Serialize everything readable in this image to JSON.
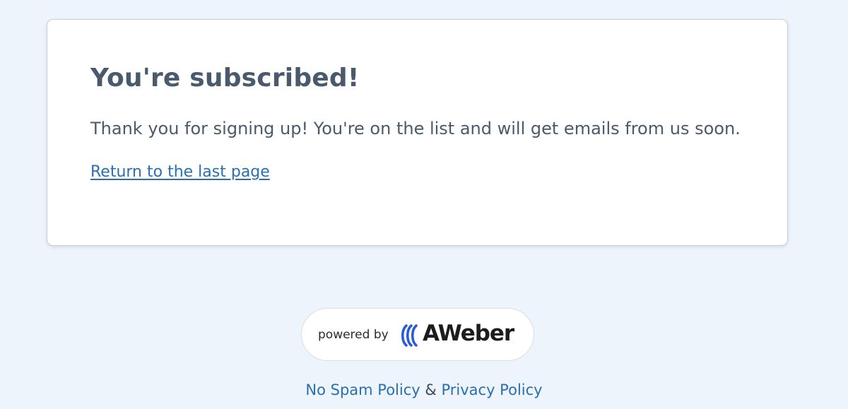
{
  "card": {
    "title": "You're subscribed!",
    "message": "Thank you for signing up! You're on the list and will get emails from us soon.",
    "return_link": "Return to the last page"
  },
  "badge": {
    "powered_by": "powered by",
    "brand": "AWeber",
    "logo_icon": "aweber-logo-icon",
    "brand_color": "#2a5bd7"
  },
  "footer": {
    "no_spam_link": "No Spam Policy",
    "separator": "&",
    "privacy_link": "Privacy Policy"
  }
}
